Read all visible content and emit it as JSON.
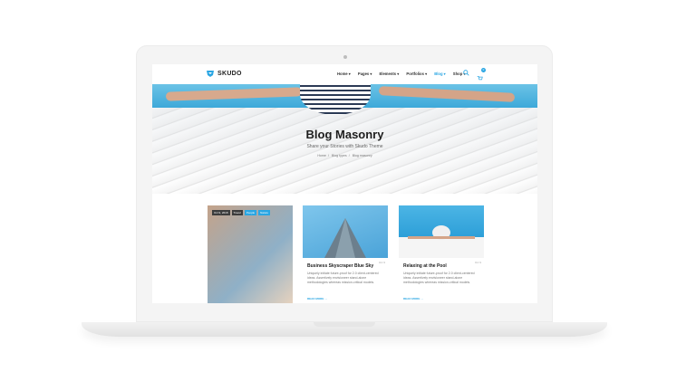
{
  "brand": {
    "name": "SKUDO",
    "accent": "#2aa6e3"
  },
  "nav": {
    "items": [
      {
        "label": "Home ▾"
      },
      {
        "label": "Pages ▾"
      },
      {
        "label": "Elements ▾"
      },
      {
        "label": "Portfolios ▾"
      },
      {
        "label": "Blog ▾"
      },
      {
        "label": "Shop ▾"
      }
    ],
    "active_index": 4,
    "cart_count": "0"
  },
  "hero": {
    "title": "Blog Masonry",
    "subtitle": "Share your Stories with Skudo Theme",
    "breadcrumb": [
      "Home",
      "Blog types",
      "Blog masonry"
    ]
  },
  "cards": [
    {
      "tags": [
        "Oct 9, 2018",
        "Travel",
        "People",
        "Nature"
      ]
    },
    {
      "title": "Business Skyscraper Blue Sky",
      "text": "Uniquely initiate future-proof for 2.0 client-centered ideas. Assertively envisioneer stand-alone methodologies whereas mission-critical models.",
      "read_more": "READ MORE →",
      "date": "Oct 9"
    },
    {
      "title": "Relaxing at the Pool",
      "text": "Uniquely initiate future-proof for 2.0 client-centered ideas. Assertively envisioneer stand-alone methodologies whereas mission-critical models.",
      "read_more": "READ MORE →",
      "date": "Oct 9"
    }
  ]
}
